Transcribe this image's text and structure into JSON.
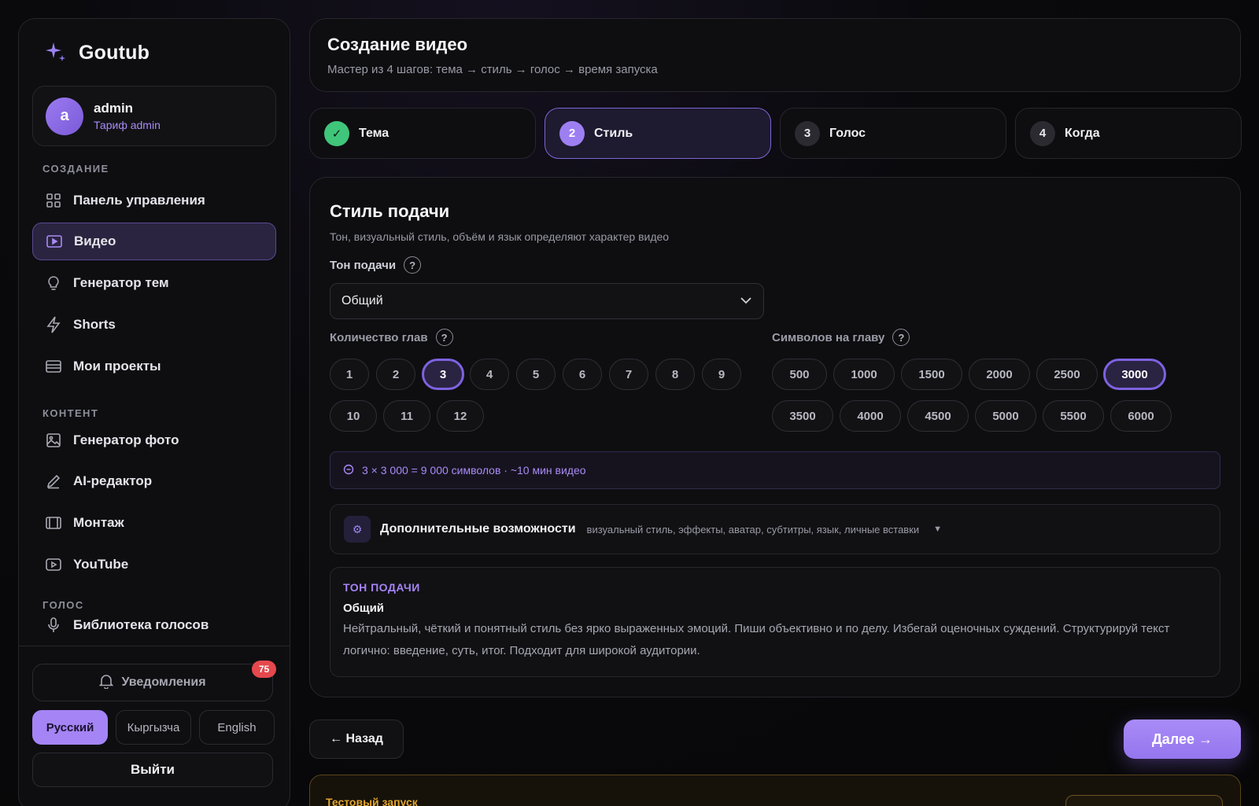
{
  "brand": {
    "name": "Goutub"
  },
  "user": {
    "initial": "a",
    "name": "admin",
    "plan": "Тариф admin"
  },
  "sidebar": {
    "sections": {
      "creation": "СОЗДАНИЕ",
      "content": "КОНТЕНТ",
      "voice": "ГОЛОС"
    },
    "items": [
      {
        "label": "Панель управления",
        "icon": "grid-icon"
      },
      {
        "label": "Видео",
        "icon": "video-icon",
        "active": true
      },
      {
        "label": "Генератор тем",
        "icon": "lightbulb-icon"
      },
      {
        "label": "Shorts",
        "icon": "lightning-icon"
      },
      {
        "label": "Мои проекты",
        "icon": "list-icon"
      },
      {
        "label": "Генератор фото",
        "icon": "image-icon"
      },
      {
        "label": "AI-редактор",
        "icon": "pen-icon"
      },
      {
        "label": "Монтаж",
        "icon": "film-icon"
      },
      {
        "label": "YouTube",
        "icon": "youtube-icon"
      },
      {
        "label": "Библиотека голосов",
        "icon": "mic-icon"
      }
    ],
    "notifications": {
      "label": "Уведомления",
      "count": "75"
    },
    "languages": [
      "Русский",
      "Кыргызча",
      "English"
    ],
    "active_language": "Русский",
    "logout": "Выйти"
  },
  "header": {
    "title": "Создание видео",
    "subtitle": "Мастер из 4 шагов: тема → стиль → голос → время запуска"
  },
  "steps": [
    {
      "num": "✓",
      "label": "Тема",
      "state": "done"
    },
    {
      "num": "2",
      "label": "Стиль",
      "state": "current"
    },
    {
      "num": "3",
      "label": "Голос",
      "state": "pending"
    },
    {
      "num": "4",
      "label": "Когда",
      "state": "pending"
    }
  ],
  "form": {
    "title": "Стиль подачи",
    "subtitle": "Тон, визуальный стиль, объём и язык определяют характер видео",
    "tone": {
      "label": "Тон подачи",
      "value": "Общий"
    },
    "chapters": {
      "label": "Количество глав",
      "options": [
        "1",
        "2",
        "3",
        "4",
        "5",
        "6",
        "7",
        "8",
        "9",
        "10",
        "11",
        "12"
      ],
      "selected": "3"
    },
    "chars": {
      "label": "Символов на главу",
      "options": [
        "500",
        "1000",
        "1500",
        "2000",
        "2500",
        "3000",
        "3500",
        "4000",
        "4500",
        "5000",
        "5500",
        "6000"
      ],
      "selected": "3000"
    },
    "summary": "3 × 3 000 = 9 000 символов · ~10 мин видео",
    "extras": {
      "title": "Дополнительные возможности",
      "desc": "визуальный стиль, эффекты, аватар, субтитры, язык, личные вставки"
    },
    "tone_info": {
      "label": "ТОН ПОДАЧИ",
      "name": "Общий",
      "desc": "Нейтральный, чёткий и понятный стиль без ярко выраженных эмоций. Пиши объективно и по делу. Избегай оценочных суждений. Структурируй текст логично: введение, суть, итог. Подходит для широкой аудитории."
    }
  },
  "nav": {
    "back": "← Назад",
    "next": "Далее →"
  },
  "test_run": {
    "title": "Тестовый запуск"
  },
  "colors": {
    "accent": "#a584f5",
    "success": "#3fc67a",
    "badge": "#e5484d",
    "warning": "#e3a52c"
  }
}
